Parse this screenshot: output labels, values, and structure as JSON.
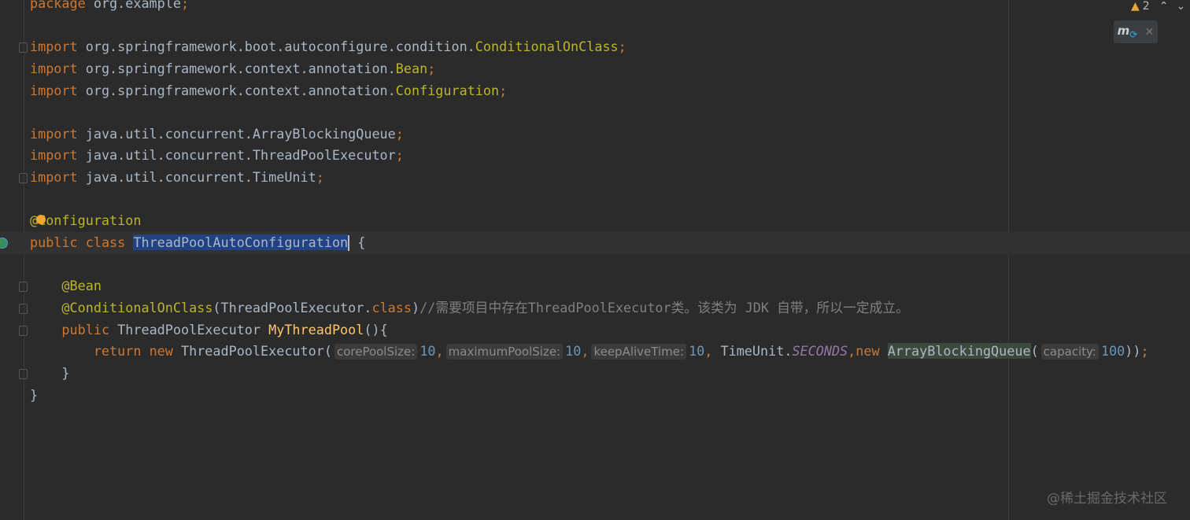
{
  "editor": {
    "lines": [
      {
        "tokens": [
          {
            "t": "package ",
            "c": "kw"
          },
          {
            "t": "org.example"
          },
          {
            "t": ";",
            "c": "kw"
          }
        ]
      },
      {
        "tokens": []
      },
      {
        "fold": true,
        "tokens": [
          {
            "t": "import ",
            "c": "kw"
          },
          {
            "t": "org.springframework.boot.autoconfigure.condition."
          },
          {
            "t": "ConditionalOnClass",
            "c": "an"
          },
          {
            "t": ";",
            "c": "kw"
          }
        ]
      },
      {
        "tokens": [
          {
            "t": "import ",
            "c": "kw"
          },
          {
            "t": "org.springframework.context.annotation."
          },
          {
            "t": "Bean",
            "c": "an"
          },
          {
            "t": ";",
            "c": "kw"
          }
        ]
      },
      {
        "tokens": [
          {
            "t": "import ",
            "c": "kw"
          },
          {
            "t": "org.springframework.context.annotation."
          },
          {
            "t": "Configuration",
            "c": "an"
          },
          {
            "t": ";",
            "c": "kw"
          }
        ]
      },
      {
        "tokens": []
      },
      {
        "tokens": [
          {
            "t": "import ",
            "c": "kw"
          },
          {
            "t": "java.util.concurrent.ArrayBlockingQueue"
          },
          {
            "t": ";",
            "c": "kw"
          }
        ]
      },
      {
        "tokens": [
          {
            "t": "import ",
            "c": "kw"
          },
          {
            "t": "java.util.concurrent.ThreadPoolExecutor"
          },
          {
            "t": ";",
            "c": "kw"
          }
        ]
      },
      {
        "fold": true,
        "tokens": [
          {
            "t": "import ",
            "c": "kw"
          },
          {
            "t": "java.util.concurrent.TimeUnit"
          },
          {
            "t": ";",
            "c": "kw"
          }
        ]
      },
      {
        "tokens": []
      },
      {
        "bulb": true,
        "tokens": [
          {
            "t": "@Configuration",
            "c": "an"
          }
        ]
      },
      {
        "current": true,
        "run": true,
        "tokens": [
          {
            "t": "public ",
            "c": "kw"
          },
          {
            "t": "class ",
            "c": "kw"
          },
          {
            "t": "ThreadPoolAutoConfiguration",
            "c": "sel"
          },
          {
            "caret": true
          },
          {
            "t": " {"
          }
        ]
      },
      {
        "tokens": []
      },
      {
        "fold": true,
        "tokens": [
          {
            "t": "    "
          },
          {
            "t": "@Bean",
            "c": "an"
          }
        ]
      },
      {
        "fold": true,
        "tokens": [
          {
            "t": "    "
          },
          {
            "t": "@ConditionalOnClass",
            "c": "an"
          },
          {
            "t": "(ThreadPoolExecutor."
          },
          {
            "t": "class",
            "c": "kw"
          },
          {
            "t": ")"
          },
          {
            "t": "//需要项目中存在ThreadPoolExecutor类。该类为 JDK 自带，所以一定成立。",
            "c": "cm"
          }
        ]
      },
      {
        "fold": true,
        "tokens": [
          {
            "t": "    "
          },
          {
            "t": "public ",
            "c": "kw"
          },
          {
            "t": "ThreadPoolExecutor "
          },
          {
            "t": "MyThreadPool",
            "c": "md"
          },
          {
            "t": "(){"
          }
        ]
      },
      {
        "tokens": [
          {
            "t": "        "
          },
          {
            "t": "return ",
            "c": "kw"
          },
          {
            "t": "new ",
            "c": "kw"
          },
          {
            "t": "ThreadPoolExecutor("
          },
          {
            "t": "corePoolSize:",
            "c": "hint"
          },
          {
            "t": "10",
            "c": "num"
          },
          {
            "t": ",",
            "c": "kw"
          },
          {
            "t": "maximumPoolSize:",
            "c": "hint"
          },
          {
            "t": "10",
            "c": "num"
          },
          {
            "t": ",",
            "c": "kw"
          },
          {
            "t": "keepAliveTime:",
            "c": "hint"
          },
          {
            "t": "10",
            "c": "num"
          },
          {
            "t": ", ",
            "c": "kw"
          },
          {
            "t": "TimeUnit."
          },
          {
            "t": "SECONDS",
            "c": "st"
          },
          {
            "t": ",",
            "c": "kw"
          },
          {
            "t": "new ",
            "c": "kw"
          },
          {
            "t": "ArrayBlockingQueue",
            "c": "hl"
          },
          {
            "t": "("
          },
          {
            "t": "capacity:",
            "c": "hint"
          },
          {
            "t": "100",
            "c": "num"
          },
          {
            "t": "))"
          },
          {
            "t": ";",
            "c": "kw"
          }
        ]
      },
      {
        "fold": true,
        "tokens": [
          {
            "t": "    }"
          }
        ]
      },
      {
        "tokens": [
          {
            "t": "}"
          }
        ]
      }
    ]
  },
  "status": {
    "warning_count": "2",
    "warning_icon": "warning-triangle-icon"
  },
  "maven_popup": {
    "icon": "maven-reload-icon",
    "label": "m"
  },
  "watermark": "@稀土掘金技术社区"
}
